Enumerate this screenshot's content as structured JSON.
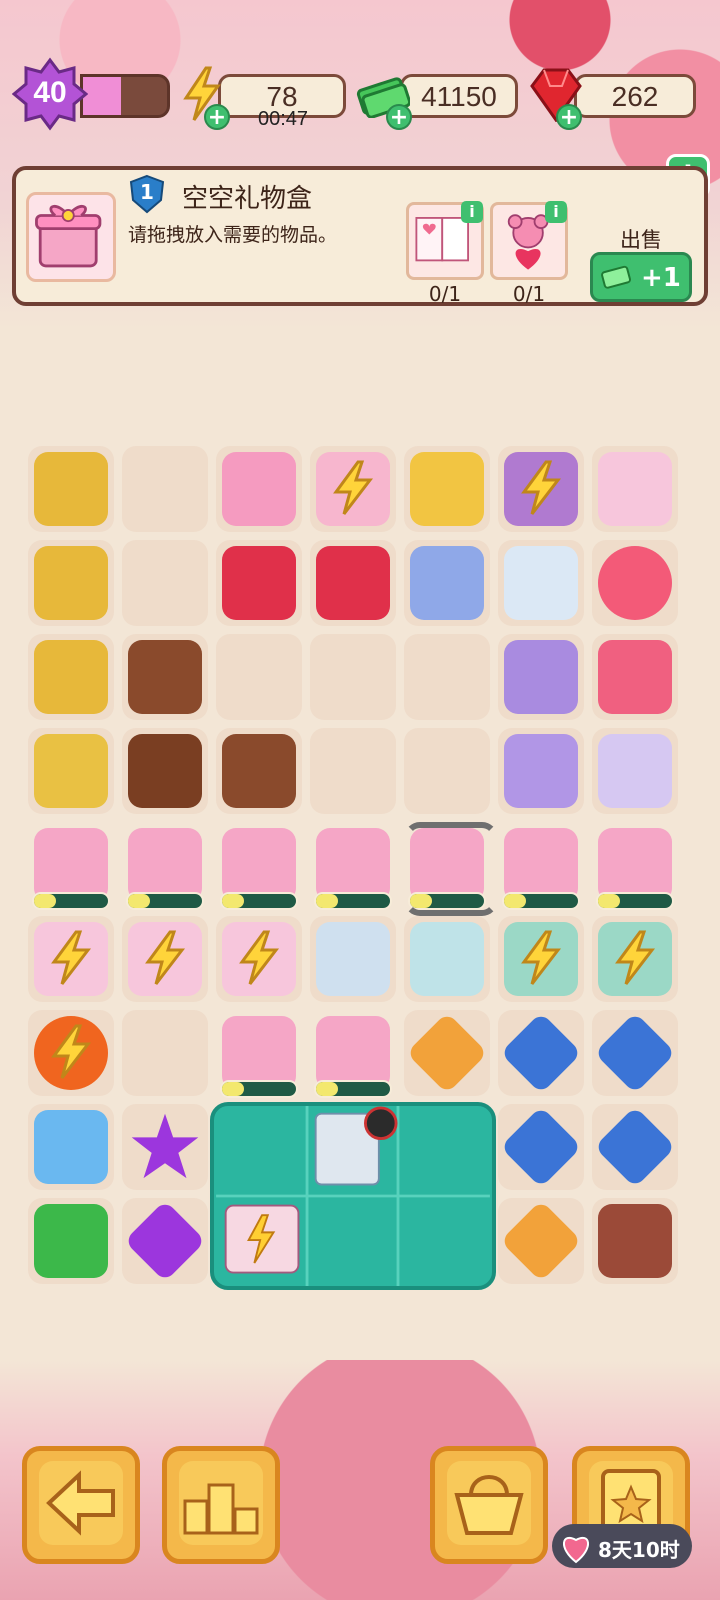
{
  "hud": {
    "level": "40",
    "xp_progress": 0.45,
    "energy": "78",
    "energy_timer": "00:47",
    "cash": "41150",
    "gems": "262"
  },
  "info_panel": {
    "badge_level": "1",
    "title": "空空礼物盒",
    "description": "请拖拽放入需要的物品。",
    "requirements": [
      {
        "icon": "love-letter-book-icon",
        "count": "0/1"
      },
      {
        "icon": "teddy-bear-icon",
        "count": "0/1"
      }
    ],
    "sell_label": "出售",
    "sell_value": "+1",
    "info_icon": "i"
  },
  "board": {
    "rows": [
      [
        "chocolate-card-icon",
        "",
        "gift-machine-icon",
        "energy-gift-cake-icon",
        "candelabra-icon",
        "energy-photo-frame-icon",
        "unicorn-icon"
      ],
      [
        "chocolate-card-icon",
        "",
        "rose-bouquet-icon",
        "single-rose-icon",
        "ferris-wheel-icon",
        "letter-icon",
        "heart-balloon-icon"
      ],
      [
        "chocolate-card-icon",
        "heart-chocolate-icon",
        "",
        "",
        "",
        "diary-icon",
        "balloon-bunch-icon"
      ],
      [
        "gold-bars-icon",
        "chocolates-icon",
        "chocolate-piece-icon",
        "",
        "",
        "dolphin-icon",
        "ticket-icon"
      ],
      [
        "gift-box-icon",
        "gift-box-icon",
        "gift-box-icon",
        "gift-box-icon",
        "gift-box-icon",
        "gift-box-icon",
        "gift-box-icon"
      ],
      [
        "energy-card-icon",
        "energy-card-icon",
        "energy-card-icon",
        "letters-icon",
        "open-book-icon",
        "energy-letters-icon",
        "energy-letters-icon"
      ],
      [
        "energy-orb-icon",
        "",
        "gift-box-icon",
        "gift-box-icon",
        "orange-hourglass-icon",
        "blue-hourglass-icon",
        "blue-hourglass-icon"
      ],
      [
        "blue-chocolate-box-icon",
        "purple-star-icon",
        "",
        "",
        "",
        "blue-hourglass-icon",
        "blue-hourglass-icon"
      ],
      [
        "cash-pile-icon",
        "purple-gem-icon",
        "",
        "",
        "",
        "orange-hourglass-icon",
        "retro-tv-icon"
      ]
    ]
  },
  "bottom_bar": {
    "buttons": [
      "back-arrow-icon",
      "podium-icon",
      "basket-icon",
      "clipboard-star-icon"
    ],
    "event_timer": "8天10时"
  },
  "colors": {
    "accent_green": "#3fbf6f",
    "panel_bg": "#f7ecd9",
    "border_brown": "#6f3f34",
    "teal_area": "#2bb6a0",
    "button_yellow": "#f4b84a"
  }
}
